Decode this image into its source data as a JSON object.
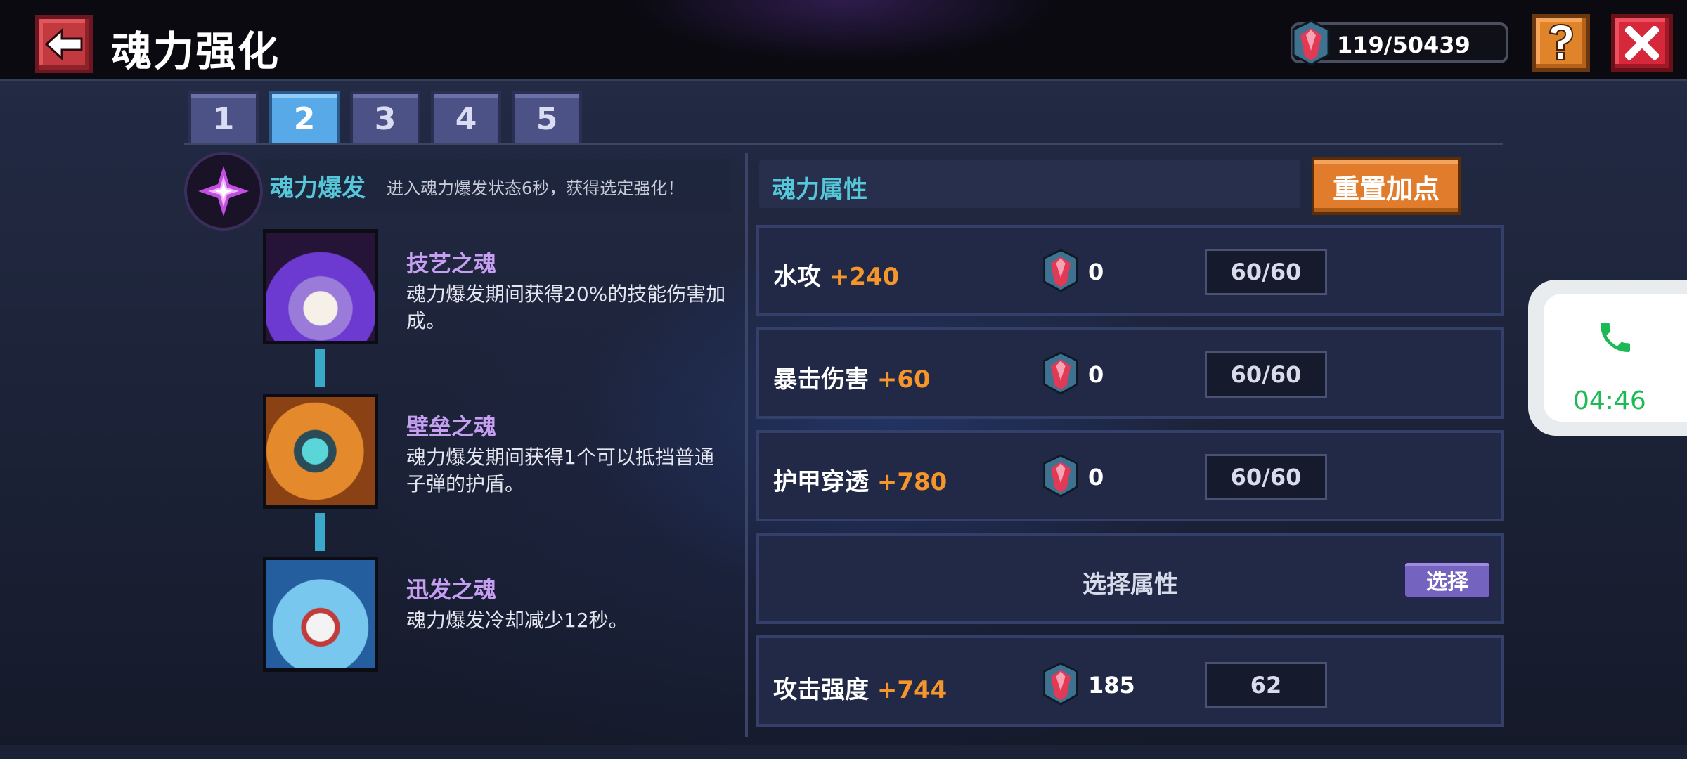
{
  "header": {
    "title": "魂力强化",
    "currency": "119/50439",
    "back_icon": "arrow-left-icon",
    "help_icon": "question-icon",
    "close_icon": "close-icon"
  },
  "tabs": [
    "1",
    "2",
    "3",
    "4",
    "5"
  ],
  "active_tab": "2",
  "burst": {
    "title": "魂力爆发",
    "description": "进入魂力爆发状态6秒，获得选定强化！"
  },
  "skills": [
    {
      "name": "技艺之魂",
      "desc": "魂力爆发期间获得20%的技能伤害加成。"
    },
    {
      "name": "壁垒之魂",
      "desc": "魂力爆发期间获得1个可以抵挡普通子弹的护盾。"
    },
    {
      "name": "迅发之魂",
      "desc": "魂力爆发冷却减少12秒。"
    }
  ],
  "attributes": {
    "header": "魂力属性",
    "reset_label": "重置加点",
    "rows": [
      {
        "name": "水攻",
        "bonus": "+240",
        "count": "0",
        "level": "60/60"
      },
      {
        "name": "暴击伤害",
        "bonus": "+60",
        "count": "0",
        "level": "60/60"
      },
      {
        "name": "护甲穿透",
        "bonus": "+780",
        "count": "0",
        "level": "60/60"
      }
    ],
    "select_label": "选择属性",
    "select_button": "选择",
    "last_row": {
      "name": "攻击强度",
      "bonus": "+744",
      "count": "185",
      "level": "62"
    }
  },
  "call": {
    "time": "04:46",
    "icon": "phone-icon"
  },
  "colors": {
    "accent_cyan": "#56c7d8",
    "bonus_orange": "#f4962b",
    "skill_name": "#c69ef2",
    "call_green": "#1db954"
  }
}
